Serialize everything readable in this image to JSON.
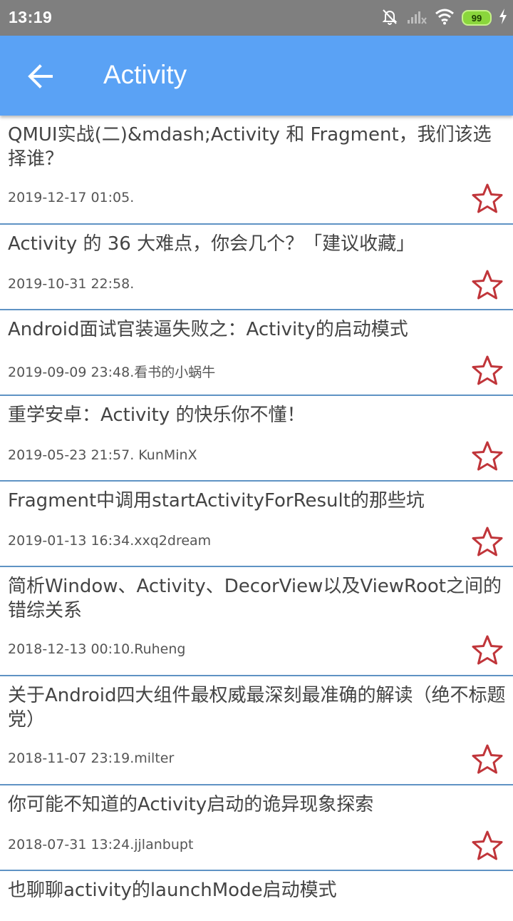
{
  "status_bar": {
    "time": "13:19",
    "icons": [
      "muted-bell-icon",
      "signal-icon",
      "wifi-icon",
      "battery-icon",
      "charging-icon"
    ],
    "battery_level": "99"
  },
  "app_bar": {
    "title": "Activity",
    "back_icon": "arrow-left-icon",
    "background": "#5aa2f5"
  },
  "colors": {
    "star": "#c0353a",
    "divider": "#5f93c4"
  },
  "articles": [
    {
      "title": "QMUI实战(二)&mdash;Activity 和 Fragment，我们该选择谁？",
      "meta": "2019-12-17 01:05."
    },
    {
      "title": "Activity 的 36 大难点，你会几个？「建议收藏」",
      "meta": "2019-10-31 22:58."
    },
    {
      "title": "Android面试官装逼失败之：Activity的启动模式",
      "meta": "2019-09-09 23:48.看书的小蜗牛"
    },
    {
      "title": "重学安卓：Activity 的快乐你不懂！",
      "meta": "2019-05-23 21:57. KunMinX"
    },
    {
      "title": "Fragment中调用startActivityForResult的那些坑",
      "meta": "2019-01-13 16:34.xxq2dream"
    },
    {
      "title": "简析Window、Activity、DecorView以及ViewRoot之间的错综关系",
      "meta": "2018-12-13 00:10.Ruheng"
    },
    {
      "title": "关于Android四大组件最权威最深刻最准确的解读（绝不标题党）",
      "meta": "2018-11-07 23:19.milter"
    },
    {
      "title": "你可能不知道的Activity启动的诡异现象探索",
      "meta": "2018-07-31 13:24.jjlanbupt"
    },
    {
      "title": "也聊聊activity的launchMode启动模式",
      "meta": ""
    }
  ]
}
